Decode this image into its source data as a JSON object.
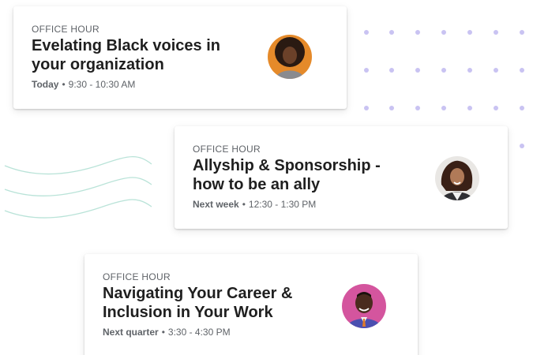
{
  "cards": [
    {
      "eyebrow": "OFFICE HOUR",
      "title": "Evelating Black voices in your organization",
      "when": "Today",
      "separator": "•",
      "time": "9:30 - 10:30 AM"
    },
    {
      "eyebrow": "OFFICE HOUR",
      "title": "Allyship & Sponsorship - how to be an ally",
      "when": "Next week",
      "separator": "•",
      "time": "12:30 - 1:30 PM"
    },
    {
      "eyebrow": "OFFICE HOUR",
      "title": "Navigating Your Career & Inclusion in Your Work",
      "when": "Next quarter",
      "separator": "•",
      "time": "3:30 - 4:30 PM"
    }
  ],
  "colors": {
    "dot": "#c9c3f2",
    "wave": "#b9e3d8",
    "title": "#1f1f1f",
    "muted": "#5f6368"
  }
}
